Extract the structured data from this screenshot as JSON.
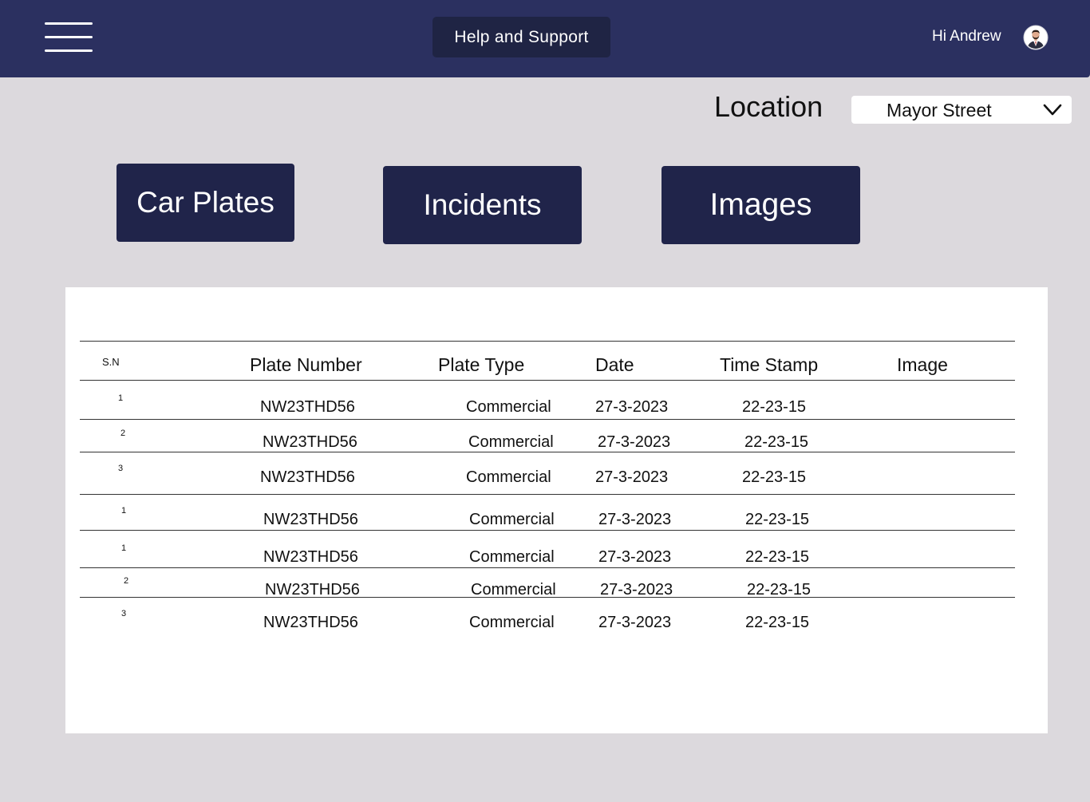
{
  "header": {
    "menu_icon": "hamburger-menu-icon",
    "help_label": "Help and Support",
    "greeting": "Hi Andrew",
    "avatar_icon": "user-avatar-icon"
  },
  "location": {
    "label": "Location",
    "selected": "Mayor Street",
    "dropdown_icon": "chevron-down-icon"
  },
  "categories": {
    "car_plates": "Car Plates",
    "incidents": "Incidents",
    "images": "Images"
  },
  "table": {
    "headers": [
      "S.N",
      "Plate Number",
      "Plate Type",
      "Date",
      "Time Stamp",
      "Image"
    ],
    "rows": [
      [
        "1",
        "NW23THD56",
        "Commercial",
        "27-3-2023",
        "22-23-15",
        ""
      ],
      [
        "2",
        "NW23THD56",
        "Commercial",
        "27-3-2023",
        "22-23-15",
        ""
      ],
      [
        "3",
        "NW23THD56",
        "Commercial",
        "27-3-2023",
        "22-23-15",
        ""
      ],
      [
        "1",
        "NW23THD56",
        "Commercial",
        "27-3-2023",
        "22-23-15",
        ""
      ],
      [
        "1",
        "NW23THD56",
        "Commercial",
        "27-3-2023",
        "22-23-15",
        ""
      ],
      [
        "2",
        "NW23THD56",
        "Commercial",
        "27-3-2023",
        "22-23-15",
        ""
      ],
      [
        "3",
        "NW23THD56",
        "Commercial",
        "27-3-2023",
        "22-23-15",
        ""
      ]
    ]
  },
  "colors": {
    "header_bg": "#2b3060",
    "button_bg": "#20244a",
    "page_bg": "#dcd9dd"
  }
}
